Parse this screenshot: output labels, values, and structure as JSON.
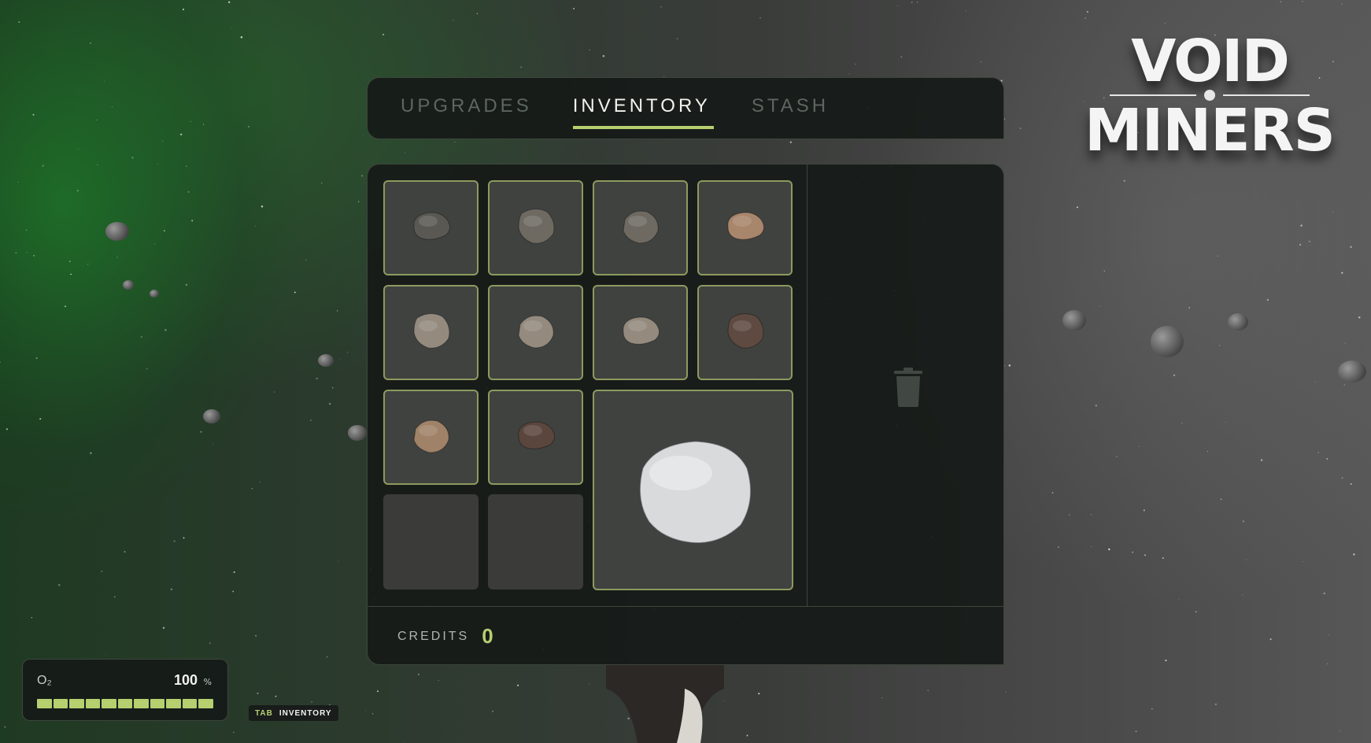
{
  "game": {
    "logo": {
      "line1": "VOID",
      "line2": "MINERS"
    }
  },
  "tabs": [
    {
      "label": "UPGRADES",
      "active": false
    },
    {
      "label": "INVENTORY",
      "active": true
    },
    {
      "label": "STASH",
      "active": false
    }
  ],
  "inventory": {
    "slots": [
      {
        "item": "dark-grey-rock-icon",
        "color": "#5a5853"
      },
      {
        "item": "grey-rock-icon",
        "color": "#6e6a62"
      },
      {
        "item": "grey-rock-icon",
        "color": "#6e6a62"
      },
      {
        "item": "tan-rock-icon",
        "color": "#a8866c"
      },
      {
        "item": "beige-rock-icon",
        "color": "#948a7e"
      },
      {
        "item": "beige-rock-icon",
        "color": "#948a7e"
      },
      {
        "item": "beige-rock-icon",
        "color": "#948a7e"
      },
      {
        "item": "brown-rock-icon",
        "color": "#5e4a40"
      },
      {
        "item": "tan-rock-icon",
        "color": "#a08268"
      },
      {
        "item": "brown-rock-icon",
        "color": "#5a463d"
      },
      {
        "item": "empty"
      },
      {
        "item": "empty"
      },
      {
        "item": "large-silver-rock-icon",
        "color": "#d8dadc"
      }
    ],
    "trash_icon": "trash-icon"
  },
  "credits": {
    "label": "CREDITS",
    "value": "0"
  },
  "hud": {
    "o2_label": "O₂",
    "o2_value": "100",
    "o2_unit": "%",
    "o2_level": 1.0,
    "o2_segments": 11,
    "hint_key": "TAB",
    "hint_action": "INVENTORY"
  },
  "colors": {
    "accent": "#b6cf6f",
    "panel": "#161a18",
    "slot": "#404240"
  }
}
